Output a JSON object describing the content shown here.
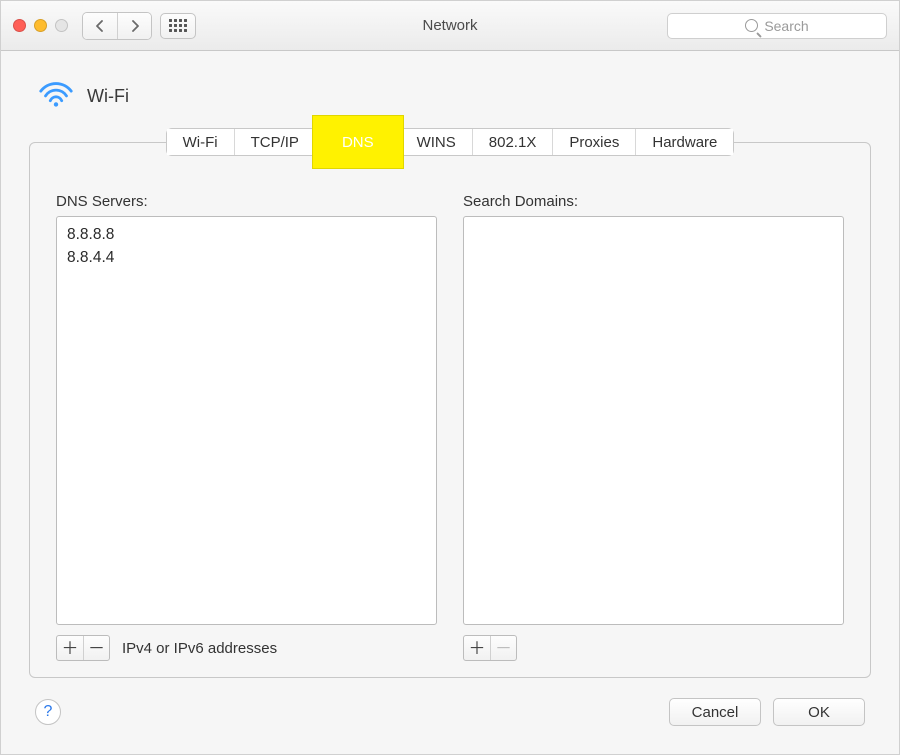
{
  "window": {
    "title": "Network"
  },
  "search": {
    "placeholder": "Search"
  },
  "header": {
    "interface_name": "Wi-Fi"
  },
  "tabs": [
    {
      "id": "wifi",
      "label": "Wi-Fi",
      "active": false
    },
    {
      "id": "tcpip",
      "label": "TCP/IP",
      "active": false
    },
    {
      "id": "dns",
      "label": "DNS",
      "active": true,
      "highlighted": true
    },
    {
      "id": "wins",
      "label": "WINS",
      "active": false
    },
    {
      "id": "8021x",
      "label": "802.1X",
      "active": false
    },
    {
      "id": "proxies",
      "label": "Proxies",
      "active": false
    },
    {
      "id": "hardware",
      "label": "Hardware",
      "active": false
    }
  ],
  "dns": {
    "servers_label": "DNS Servers:",
    "servers": [
      "8.8.8.8",
      "8.8.4.4"
    ],
    "search_domains_label": "Search Domains:",
    "search_domains": [],
    "hint": "IPv4 or IPv6 addresses"
  },
  "footer": {
    "cancel": "Cancel",
    "ok": "OK"
  }
}
